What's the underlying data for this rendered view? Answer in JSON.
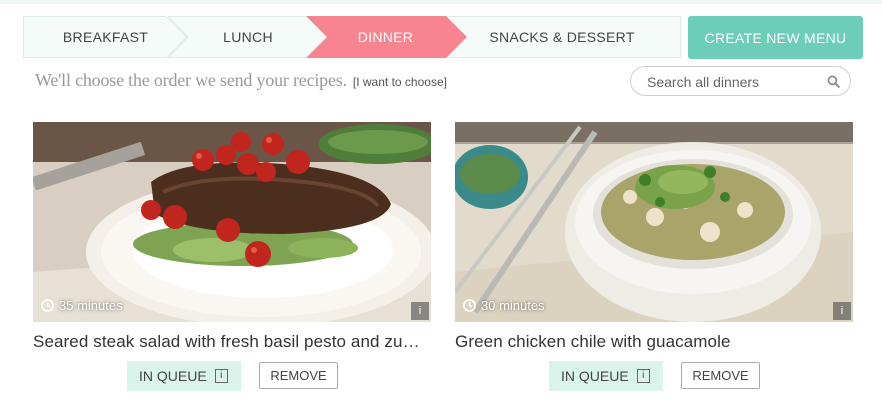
{
  "tabs": [
    {
      "label": "BREAKFAST",
      "active": false
    },
    {
      "label": "LUNCH",
      "active": false
    },
    {
      "label": "DINNER",
      "active": true
    },
    {
      "label": "SNACKS & DESSERT",
      "active": false
    }
  ],
  "create_button": {
    "label": "CREATE NEW MENU"
  },
  "subtitle": {
    "lead": "We'll choose the order we send your recipes.",
    "choose_link": "[I want to choose]"
  },
  "search": {
    "placeholder": "Search all dinners",
    "value": ""
  },
  "recipes": [
    {
      "time": "35 minutes",
      "title": "Seared steak salad with fresh basil pesto and zu…",
      "queue_label": "IN QUEUE",
      "remove_label": "REMOVE",
      "info_glyph": "i"
    },
    {
      "time": "30 minutes",
      "title": "Green chicken chile with guacamole",
      "queue_label": "IN QUEUE",
      "remove_label": "REMOVE",
      "info_glyph": "i"
    }
  ],
  "colors": {
    "accent_teal": "#6ccdb9",
    "active_tab": "#f7848f",
    "tab_bg": "#f4fbf8",
    "queue_bg": "#daf4ec"
  },
  "icons": {
    "search": "search-icon",
    "clock": "clock-icon",
    "info": "info-icon"
  }
}
